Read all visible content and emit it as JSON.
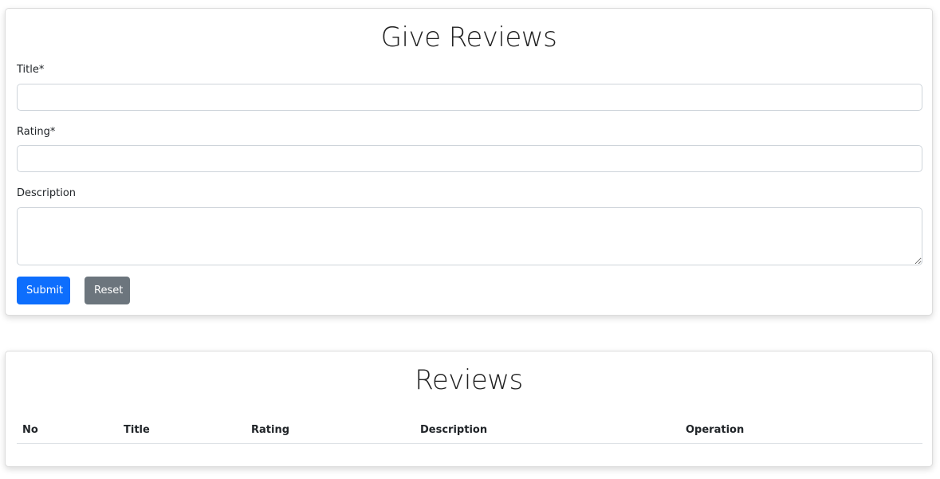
{
  "form": {
    "heading": "Give Reviews",
    "title_label": "Title*",
    "title_value": "",
    "rating_label": "Rating*",
    "rating_value": "",
    "description_label": "Description",
    "description_value": "",
    "submit_label": "Submit",
    "reset_label": "Reset"
  },
  "reviews": {
    "heading": "Reviews",
    "columns": [
      "No",
      "Title",
      "Rating",
      "Description",
      "Operation"
    ],
    "rows": []
  },
  "colors": {
    "submit": "#0d6efd",
    "reset": "#6c757d"
  }
}
